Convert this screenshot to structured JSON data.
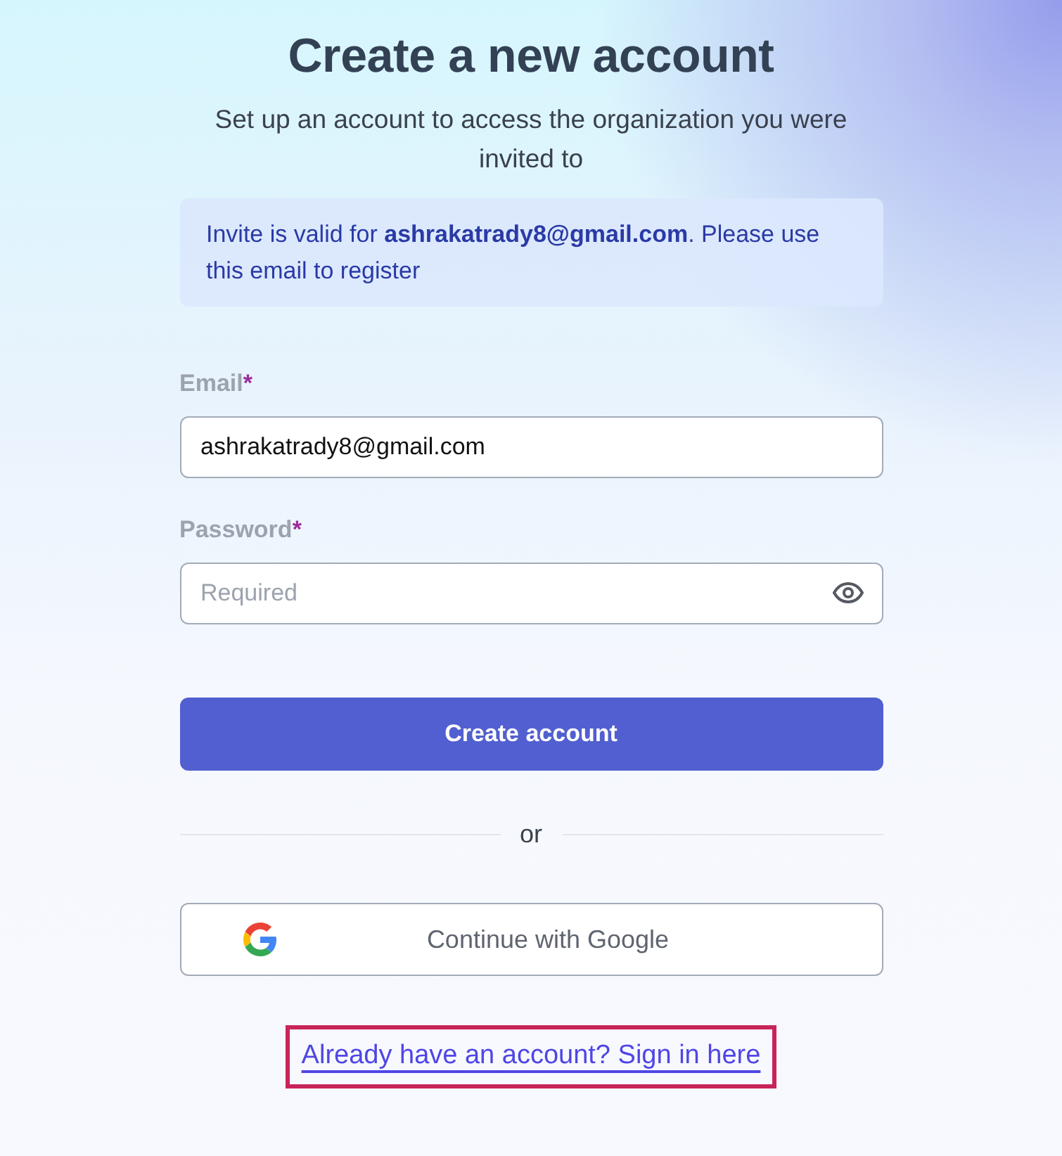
{
  "heading": "Create a new account",
  "subtitle": "Set up an account to access the organization you were invited to",
  "notice": "Invite is valid for **ashrakatrady8@gmail.com**. Please use this email to register",
  "fields": [
    {
      "kind": "email",
      "label": "Email",
      "required_mark": "*",
      "value": "ashrakatrady8@gmail.com"
    },
    {
      "kind": "password",
      "label": "Password",
      "required_mark": "*",
      "placeholder": "Required"
    }
  ],
  "primary_button": "Create account",
  "divider": "or",
  "google_button": "Continue with Google",
  "sign_in_link": {
    "text": "Already have an account? Sign in here",
    "highlighted": true
  }
}
